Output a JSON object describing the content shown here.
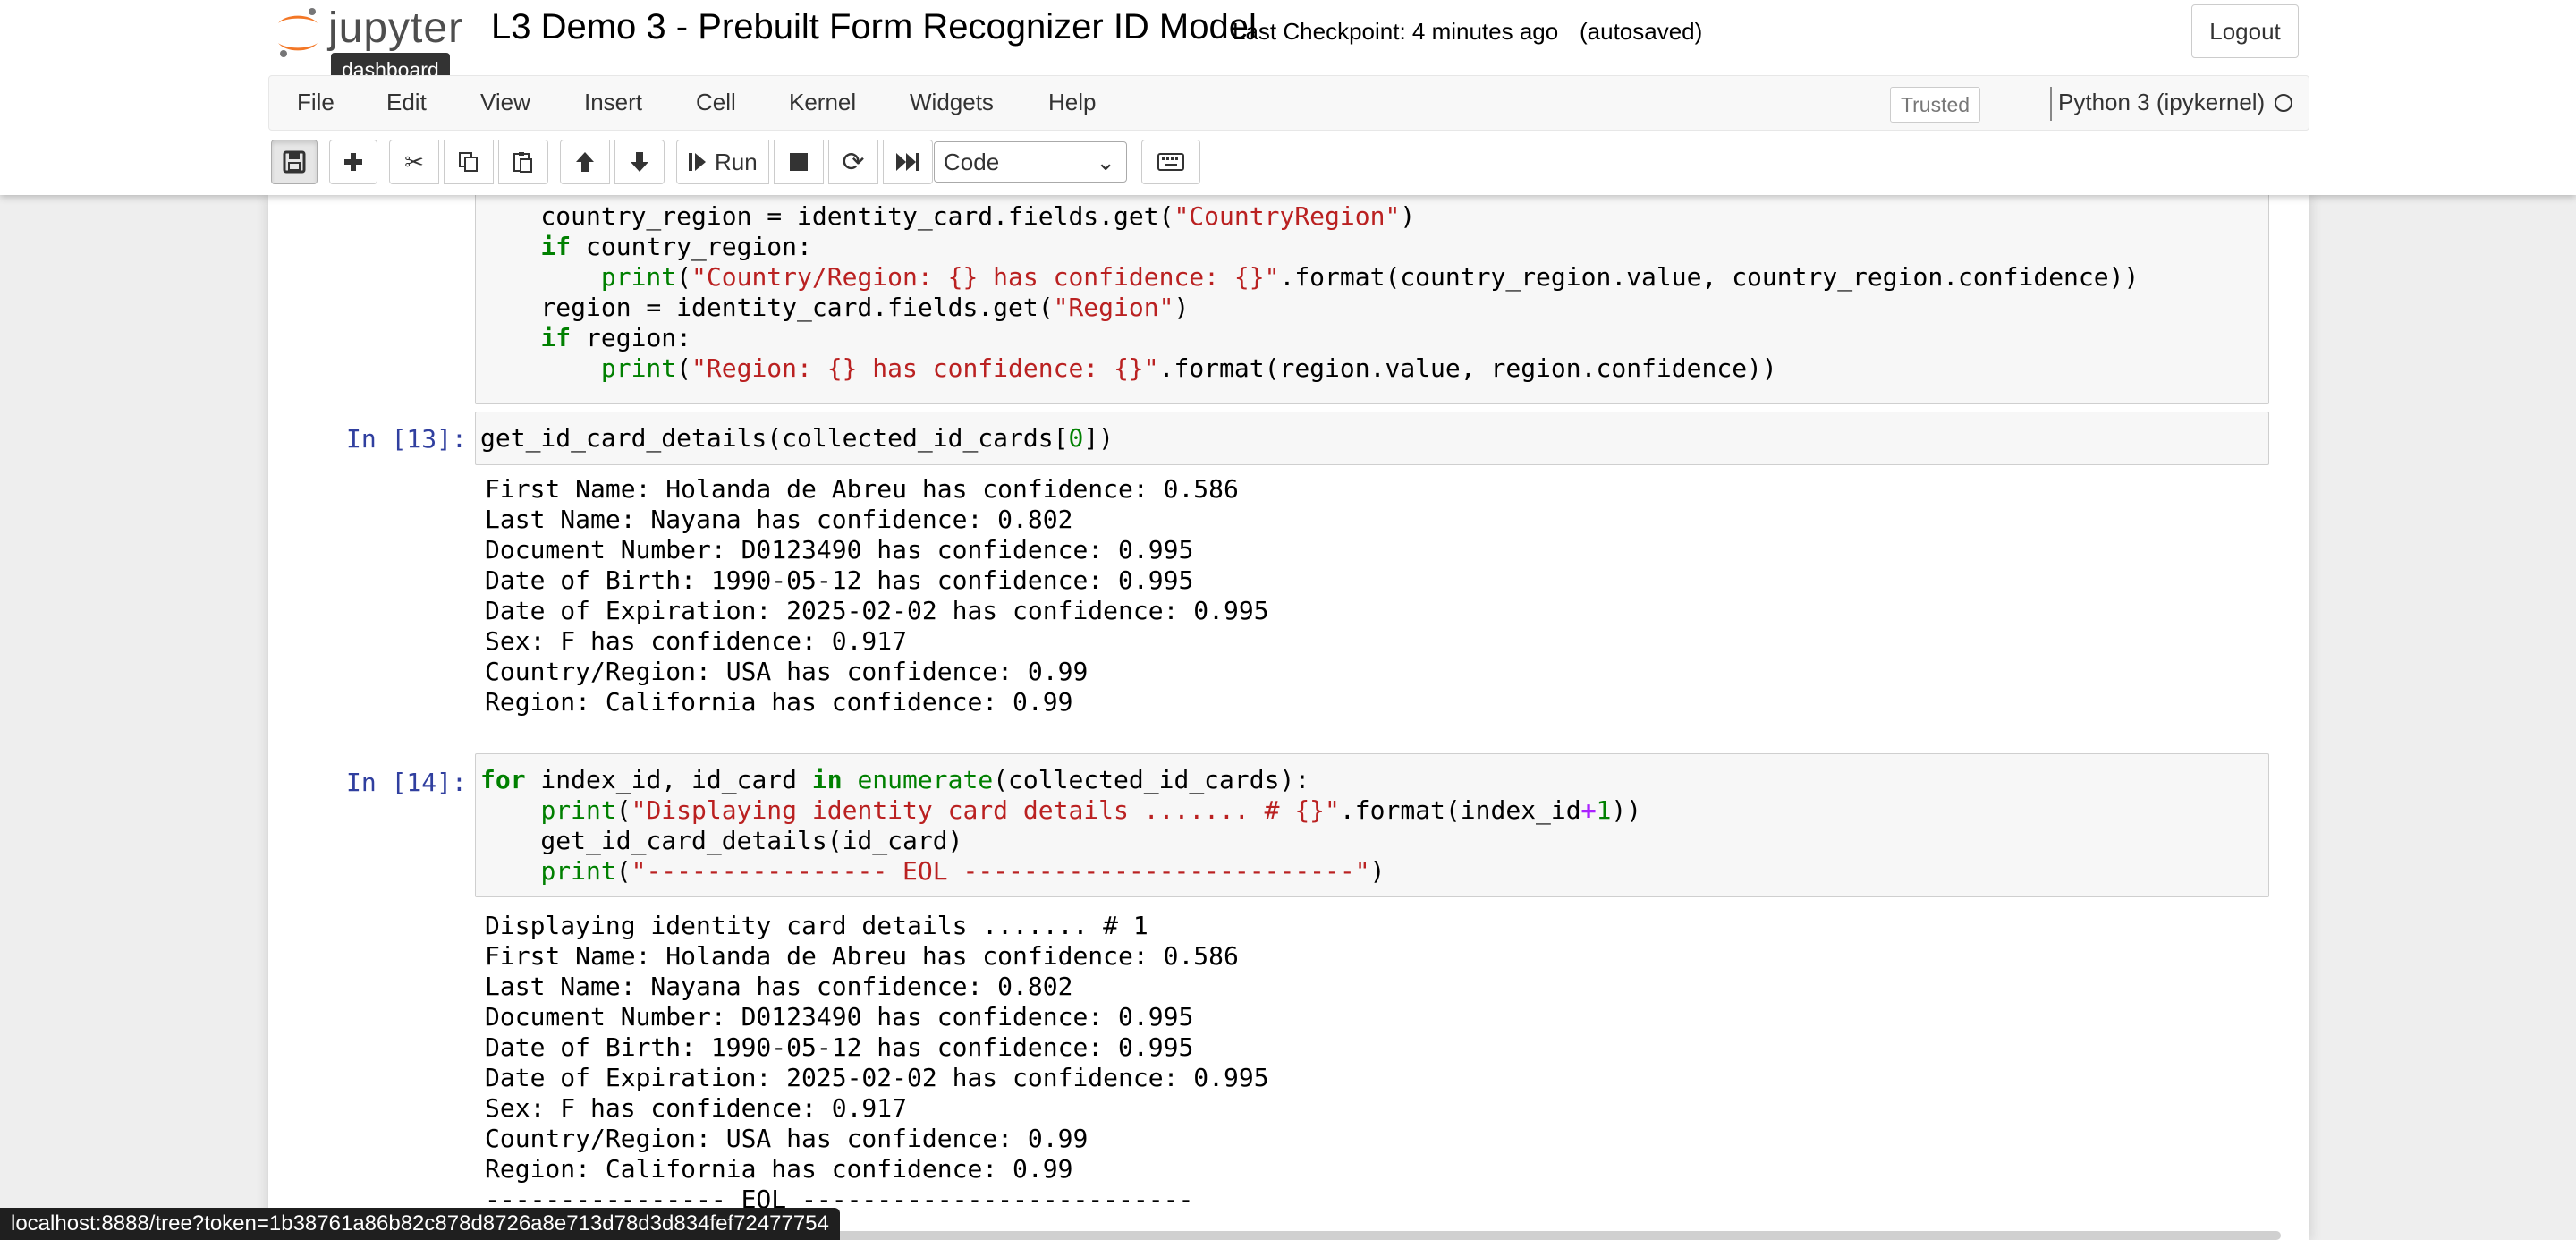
{
  "header": {
    "logo_text": "jupyter",
    "tooltip": "dashboard",
    "notebook_title": "L3 Demo 3 - Prebuilt Form Recognizer ID Model",
    "checkpoint": "Last Checkpoint: 4 minutes ago",
    "autosave_status": "(autosaved)",
    "logout_label": "Logout"
  },
  "menubar": {
    "items": [
      "File",
      "Edit",
      "View",
      "Insert",
      "Cell",
      "Kernel",
      "Widgets",
      "Help"
    ],
    "trusted_label": "Trusted",
    "kernel_name": "Python 3 (ipykernel)"
  },
  "toolbar": {
    "run_label": "Run",
    "cell_type": "Code",
    "icons": [
      "save-icon",
      "plus-icon",
      "cut-icon",
      "copy-icon",
      "paste-icon",
      "arrow-up-icon",
      "arrow-down-icon",
      "run-icon",
      "stop-icon",
      "restart-icon",
      "fast-forward-icon",
      "keyboard-icon"
    ]
  },
  "cells": {
    "prev_code": {
      "lines": [
        "    country_region = identity_card.fields.get(\"CountryRegion\")",
        "    if country_region:",
        "        print(\"Country/Region: {} has confidence: {}\".format(country_region.value, country_region.confidence))",
        "    region = identity_card.fields.get(\"Region\")",
        "    if region:",
        "        print(\"Region: {} has confidence: {}\".format(region.value, region.confidence))"
      ]
    },
    "cell13": {
      "prompt": "In [13]:",
      "code": "get_id_card_details(collected_id_cards[0])",
      "output": [
        "First Name: Holanda de Abreu has confidence: 0.586",
        "Last Name: Nayana has confidence: 0.802",
        "Document Number: D0123490 has confidence: 0.995",
        "Date of Birth: 1990-05-12 has confidence: 0.995",
        "Date of Expiration: 2025-02-02 has confidence: 0.995",
        "Sex: F has confidence: 0.917",
        "Country/Region: USA has confidence: 0.99",
        "Region: California has confidence: 0.99"
      ]
    },
    "cell14": {
      "prompt": "In [14]:",
      "code_lines": [
        "for index_id, id_card in enumerate(collected_id_cards):",
        "    print(\"Displaying identity card details ....... # {}\".format(index_id+1))",
        "    get_id_card_details(id_card)",
        "    print(\"---------------- EOL --------------------------\")"
      ],
      "output": [
        "Displaying identity card details ....... # 1",
        "First Name: Holanda de Abreu has confidence: 0.586",
        "Last Name: Nayana has confidence: 0.802",
        "Document Number: D0123490 has confidence: 0.995",
        "Date of Birth: 1990-05-12 has confidence: 0.995",
        "Date of Expiration: 2025-02-02 has confidence: 0.995",
        "Sex: F has confidence: 0.917",
        "Country/Region: USA has confidence: 0.99",
        "Region: California has confidence: 0.99",
        "---------------- EOL --------------------------"
      ]
    }
  },
  "status_bar": {
    "url": "localhost:8888/tree?token=1b38761a86b82c878d8726a8e713d78d3d834fef72477754"
  },
  "colors": {
    "prompt": "#303f9f",
    "keyword": "#008000",
    "string": "#ba2121",
    "background": "#eeeeee"
  }
}
